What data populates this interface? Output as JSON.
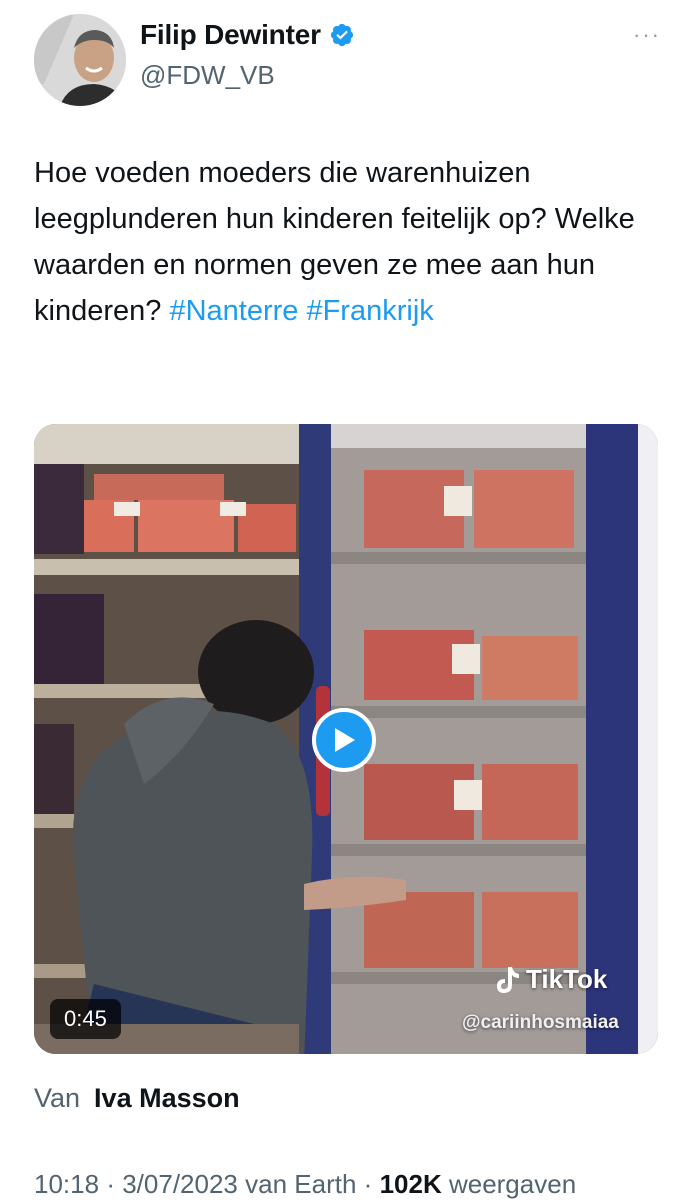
{
  "author": {
    "name": "Filip Dewinter",
    "handle": "@FDW_VB",
    "verified": true
  },
  "more_menu_label": "···",
  "tweet": {
    "text": "Hoe voeden moeders die warenhuizen leegplunderen hun kinderen feitelijk op? Welke waarden en normen geven ze mee aan hun kinderen?",
    "hashtags": [
      "#Nanterre",
      "#Frankrijk"
    ]
  },
  "media": {
    "type": "video",
    "duration": "0:45",
    "watermark": "TikTok",
    "watermark_handle": "@cariinhosmaiaa"
  },
  "credit": {
    "prefix": "Van",
    "name": "Iva Masson"
  },
  "meta": {
    "time": "10:18",
    "date": "3/07/2023",
    "source": "van Earth",
    "views_count": "102K",
    "views_label": "weergaven"
  },
  "colors": {
    "accent": "#1d9bf0",
    "text": "#0f1419",
    "secondary": "#536471"
  },
  "icons": [
    "verified-badge-icon",
    "more-icon",
    "play-icon",
    "tiktok-icon"
  ]
}
